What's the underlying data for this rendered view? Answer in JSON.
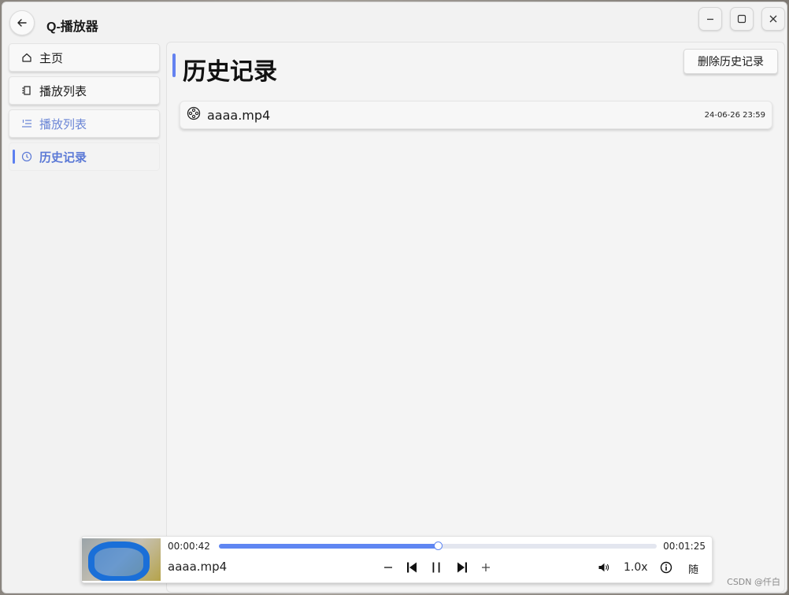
{
  "window": {
    "title": "Q-播放器"
  },
  "sidebar": {
    "items": [
      {
        "label": "主页",
        "icon": "home-icon"
      },
      {
        "label": "播放列表",
        "icon": "playlist-icon"
      },
      {
        "label": "播放列表",
        "icon": "list-icon"
      },
      {
        "label": "历史记录",
        "icon": "clock-icon"
      }
    ]
  },
  "main": {
    "title": "历史记录",
    "clear_button": "删除历史记录",
    "history": [
      {
        "name": "aaaa.mp4",
        "time": "24-06-26 23:59",
        "icon": "film-reel-icon"
      }
    ]
  },
  "player": {
    "current_time": "00:00:42",
    "total_time": "00:01:25",
    "progress": 0.5,
    "title": "aaaa.mp4",
    "speed": "1.0x",
    "shuffle": "随"
  },
  "colors": {
    "accent": "#5f86f2",
    "window_bg": "#f2f2f2",
    "sidebar_active_text": "#5b79d6"
  },
  "watermark": "CSDN @仟白"
}
